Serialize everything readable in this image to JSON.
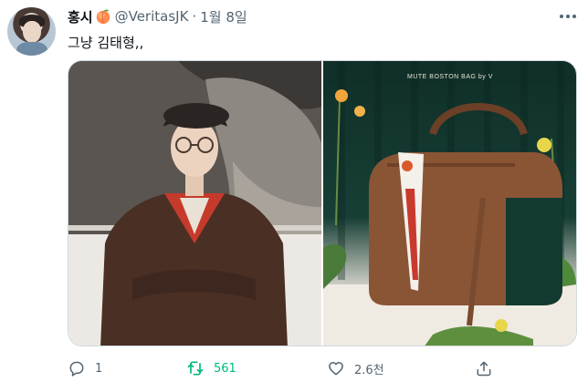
{
  "tweet": {
    "display_name": "홍시",
    "handle": "@VeritasJK",
    "separator": "·",
    "date": "1월 8일",
    "text": "그냥 김태형,,",
    "media": {
      "right_photo_text": "MUTE BOSTON BAG by V"
    },
    "actions": {
      "reply_count": "1",
      "retweet_count": "561",
      "like_count": "2.6천"
    }
  },
  "colors": {
    "text_primary": "#0f1419",
    "text_secondary": "#536471",
    "retweet_active": "#00ba7c",
    "border": "#cfd9de"
  },
  "icons": [
    "peach-emoji-icon",
    "more-options-icon",
    "reply-icon",
    "retweet-icon",
    "like-icon",
    "share-icon"
  ]
}
